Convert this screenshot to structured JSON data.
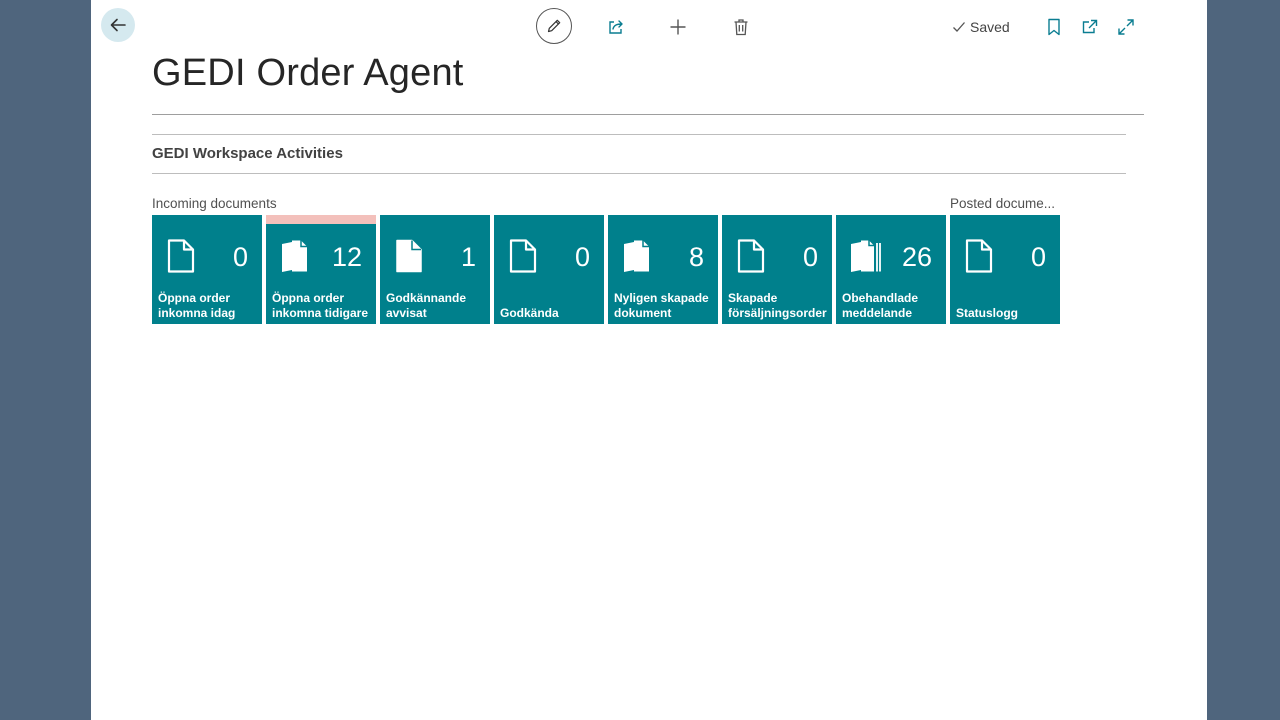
{
  "header": {
    "title": "GEDI Order Agent",
    "saved_label": "Saved"
  },
  "icons": {
    "back": "arrow-left-icon",
    "edit": "pencil-icon",
    "share": "share-icon",
    "new": "plus-icon",
    "delete": "trash-icon",
    "saved": "checkmark-icon",
    "bookmark": "bookmark-icon",
    "open_new_window": "open-in-new-window-icon",
    "expand": "expand-icon"
  },
  "section": {
    "title": "GEDI Workspace Activities"
  },
  "groups": {
    "incoming": "Incoming documents",
    "posted": "Posted docume..."
  },
  "tiles": [
    {
      "value": "0",
      "label": "Öppna order inkomna idag",
      "icon": "document-icon"
    },
    {
      "value": "12",
      "label": "Öppna order inkomna tidigare",
      "icon": "documents-icon",
      "warning": true
    },
    {
      "value": "1",
      "label": "Godkännande avvisat",
      "icon": "document-icon"
    },
    {
      "value": "0",
      "label": "Godkända",
      "icon": "document-icon"
    },
    {
      "value": "8",
      "label": "Nyligen skapade dokument",
      "icon": "documents-icon"
    },
    {
      "value": "0",
      "label": "Skapade försäljningsorder",
      "icon": "document-icon"
    },
    {
      "value": "26",
      "label": "Obehandlade meddelande",
      "icon": "document-stack-icon"
    },
    {
      "value": "0",
      "label": "Statuslogg",
      "icon": "document-icon"
    }
  ],
  "colors": {
    "tile_bg": "#00808c",
    "tile_warning": "#f3c0bb",
    "back_button_bg": "#d5e9ef",
    "frame_bg": "#4f657d"
  }
}
